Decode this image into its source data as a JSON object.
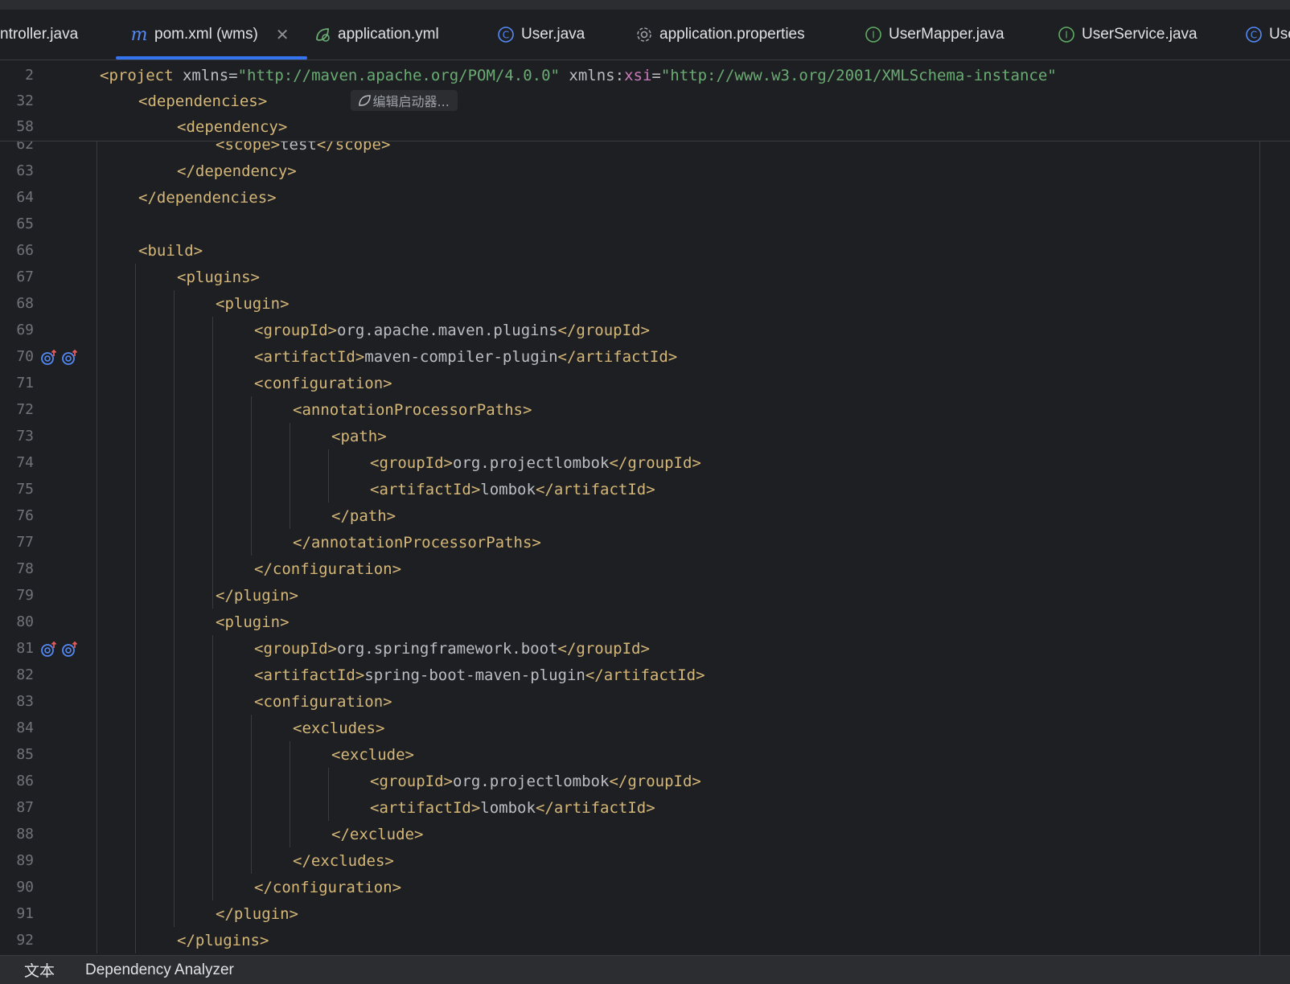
{
  "tabs": [
    {
      "label": "ntroller.java",
      "icon": "none"
    },
    {
      "label": "pom.xml (wms)",
      "icon": "maven-m-icon",
      "active": true
    },
    {
      "label": "application.yml",
      "icon": "spring-leaf-icon"
    },
    {
      "label": "User.java",
      "icon": "class-icon"
    },
    {
      "label": "application.properties",
      "icon": "gear-icon"
    },
    {
      "label": "UserMapper.java",
      "icon": "interface-icon"
    },
    {
      "label": "UserService.java",
      "icon": "interface-icon"
    },
    {
      "label": "Use",
      "icon": "class-icon"
    }
  ],
  "editor": {
    "inlay_hint": "编辑启动器...",
    "sticky_lines": [
      {
        "num": "2",
        "code": "<project xmlns=\"http://maven.apache.org/POM/4.0.0\" xmlns:xsi=\"http://www.w3.org/2001/XMLSchema-instance\""
      },
      {
        "num": "32",
        "code": "<dependencies>"
      },
      {
        "num": "58",
        "code": "<dependency>"
      }
    ],
    "lines": [
      {
        "num": "62",
        "code": "<scope>test</scope>"
      },
      {
        "num": "63",
        "code": "</dependency>"
      },
      {
        "num": "64",
        "code": "</dependencies>"
      },
      {
        "num": "65",
        "code": ""
      },
      {
        "num": "66",
        "code": "<build>"
      },
      {
        "num": "67",
        "code": "<plugins>"
      },
      {
        "num": "68",
        "code": "<plugin>"
      },
      {
        "num": "69",
        "code": "<groupId>org.apache.maven.plugins</groupId>"
      },
      {
        "num": "70",
        "code": "<artifactId>maven-compiler-plugin</artifactId>"
      },
      {
        "num": "71",
        "code": "<configuration>"
      },
      {
        "num": "72",
        "code": "<annotationProcessorPaths>"
      },
      {
        "num": "73",
        "code": "<path>"
      },
      {
        "num": "74",
        "code": "<groupId>org.projectlombok</groupId>"
      },
      {
        "num": "75",
        "code": "<artifactId>lombok</artifactId>"
      },
      {
        "num": "76",
        "code": "</path>"
      },
      {
        "num": "77",
        "code": "</annotationProcessorPaths>"
      },
      {
        "num": "78",
        "code": "</configuration>"
      },
      {
        "num": "79",
        "code": "</plugin>"
      },
      {
        "num": "80",
        "code": "<plugin>"
      },
      {
        "num": "81",
        "code": "<groupId>org.springframework.boot</groupId>"
      },
      {
        "num": "82",
        "code": "<artifactId>spring-boot-maven-plugin</artifactId>"
      },
      {
        "num": "83",
        "code": "<configuration>"
      },
      {
        "num": "84",
        "code": "<excludes>"
      },
      {
        "num": "85",
        "code": "<exclude>"
      },
      {
        "num": "86",
        "code": "<groupId>org.projectlombok</groupId>"
      },
      {
        "num": "87",
        "code": "<artifactId>lombok</artifactId>"
      },
      {
        "num": "88",
        "code": "</exclude>"
      },
      {
        "num": "89",
        "code": "</excludes>"
      },
      {
        "num": "90",
        "code": "</configuration>"
      },
      {
        "num": "91",
        "code": "</plugin>"
      },
      {
        "num": "92",
        "code": "</plugins>"
      }
    ]
  },
  "statusbar": {
    "text_tab": "文本",
    "dependency_tab": "Dependency Analyzer"
  },
  "colors": {
    "background": "#1e1f22",
    "tag": "#d5b778",
    "string": "#6aab73",
    "namespace": "#c77dbb",
    "accent": "#3574f0"
  }
}
